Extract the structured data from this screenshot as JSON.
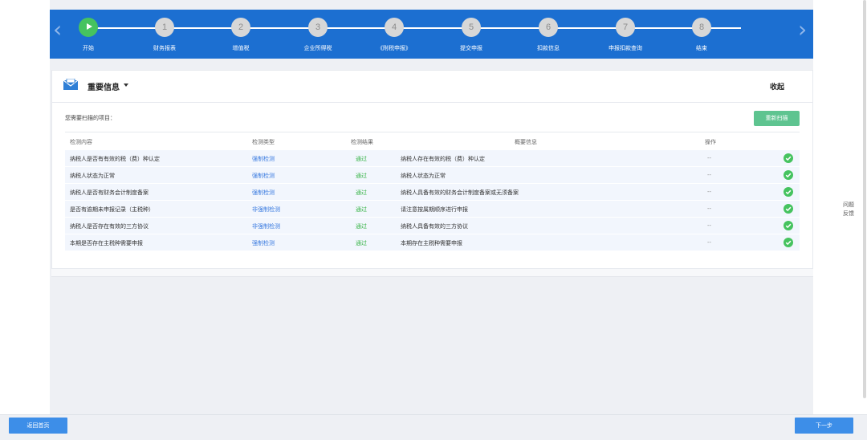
{
  "steps": [
    {
      "num": "",
      "label": "开始",
      "active": true
    },
    {
      "num": "1",
      "label": "财务报表"
    },
    {
      "num": "2",
      "label": "增值税"
    },
    {
      "num": "3",
      "label": "企业所得税"
    },
    {
      "num": "4",
      "label": "《附税申报》"
    },
    {
      "num": "5",
      "label": "提交申报"
    },
    {
      "num": "6",
      "label": "扣款信息"
    },
    {
      "num": "7",
      "label": "申报扣款查询"
    },
    {
      "num": "8",
      "label": "结束"
    }
  ],
  "panel": {
    "title": "重要信息",
    "collapse_label": "收起",
    "scan_label": "您需要扫描的项目：",
    "rescan_label": "重新扫描"
  },
  "table": {
    "headers": {
      "content": "检测内容",
      "type": "检测类型",
      "result": "检测结果",
      "info": "概要信息",
      "op": "操作"
    },
    "rows": [
      {
        "content": "纳税人是否有有效的税（费）种认定",
        "type": "强制检测",
        "result": "通过",
        "info": "纳税人存在有效的税（费）种认定",
        "op": "--"
      },
      {
        "content": "纳税人状态为正常",
        "type": "强制检测",
        "result": "通过",
        "info": "纳税人状态为正常",
        "op": "--"
      },
      {
        "content": "纳税人是否有财务会计制度备案",
        "type": "强制检测",
        "result": "通过",
        "info": "纳税人具备有效的财务会计制度备案或无须备案",
        "op": "--"
      },
      {
        "content": "是否有逾期未申报记录（主税种）",
        "type": "非强制检测",
        "result": "通过",
        "info": "请注意按属期顺序进行申报",
        "op": "--"
      },
      {
        "content": "纳税人是否存在有效的三方协议",
        "type": "非强制检测",
        "result": "通过",
        "info": "纳税人具备有效的三方协议",
        "op": "--"
      },
      {
        "content": "本期是否存在主税种需要申报",
        "type": "强制检测",
        "result": "通过",
        "info": "本期存在主税种需要申报",
        "op": "--"
      }
    ]
  },
  "feedback": {
    "line1": "问题",
    "line2": "反馈"
  },
  "footer": {
    "back_label": "返回首页",
    "next_label": "下一步"
  },
  "colors": {
    "stepbar": "#1c6fd1",
    "active_step": "#46c35f",
    "pass": "#3bb54a",
    "link": "#3a7be0",
    "button": "#3d8ee8",
    "rescan": "#5ec490"
  }
}
